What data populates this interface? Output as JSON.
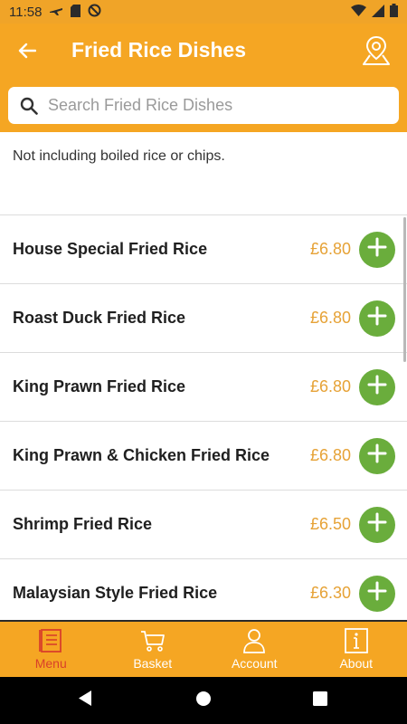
{
  "status_bar": {
    "time": "11:58"
  },
  "header": {
    "title": "Fried Rice Dishes"
  },
  "search": {
    "placeholder": "Search Fried Rice Dishes",
    "value": ""
  },
  "notice": "Not including boiled rice or chips.",
  "menu_items": [
    {
      "name": "House Special Fried Rice",
      "price": "£6.80"
    },
    {
      "name": "Roast Duck Fried Rice",
      "price": "£6.80"
    },
    {
      "name": "King Prawn Fried Rice",
      "price": "£6.80"
    },
    {
      "name": "King Prawn & Chicken Fried Rice",
      "price": "£6.80"
    },
    {
      "name": "Shrimp Fried Rice",
      "price": "£6.50"
    },
    {
      "name": "Malaysian Style Fried Rice",
      "price": "£6.30"
    }
  ],
  "bottom_nav": [
    {
      "label": "Menu",
      "icon": "menu-icon",
      "active": true
    },
    {
      "label": "Basket",
      "icon": "basket-icon",
      "active": false
    },
    {
      "label": "Account",
      "icon": "account-icon",
      "active": false
    },
    {
      "label": "About",
      "icon": "info-icon",
      "active": false
    }
  ],
  "colors": {
    "brand": "#f5a623",
    "add_button": "#6aad3c",
    "price": "#e6a236",
    "active_nav": "#d9402a"
  }
}
